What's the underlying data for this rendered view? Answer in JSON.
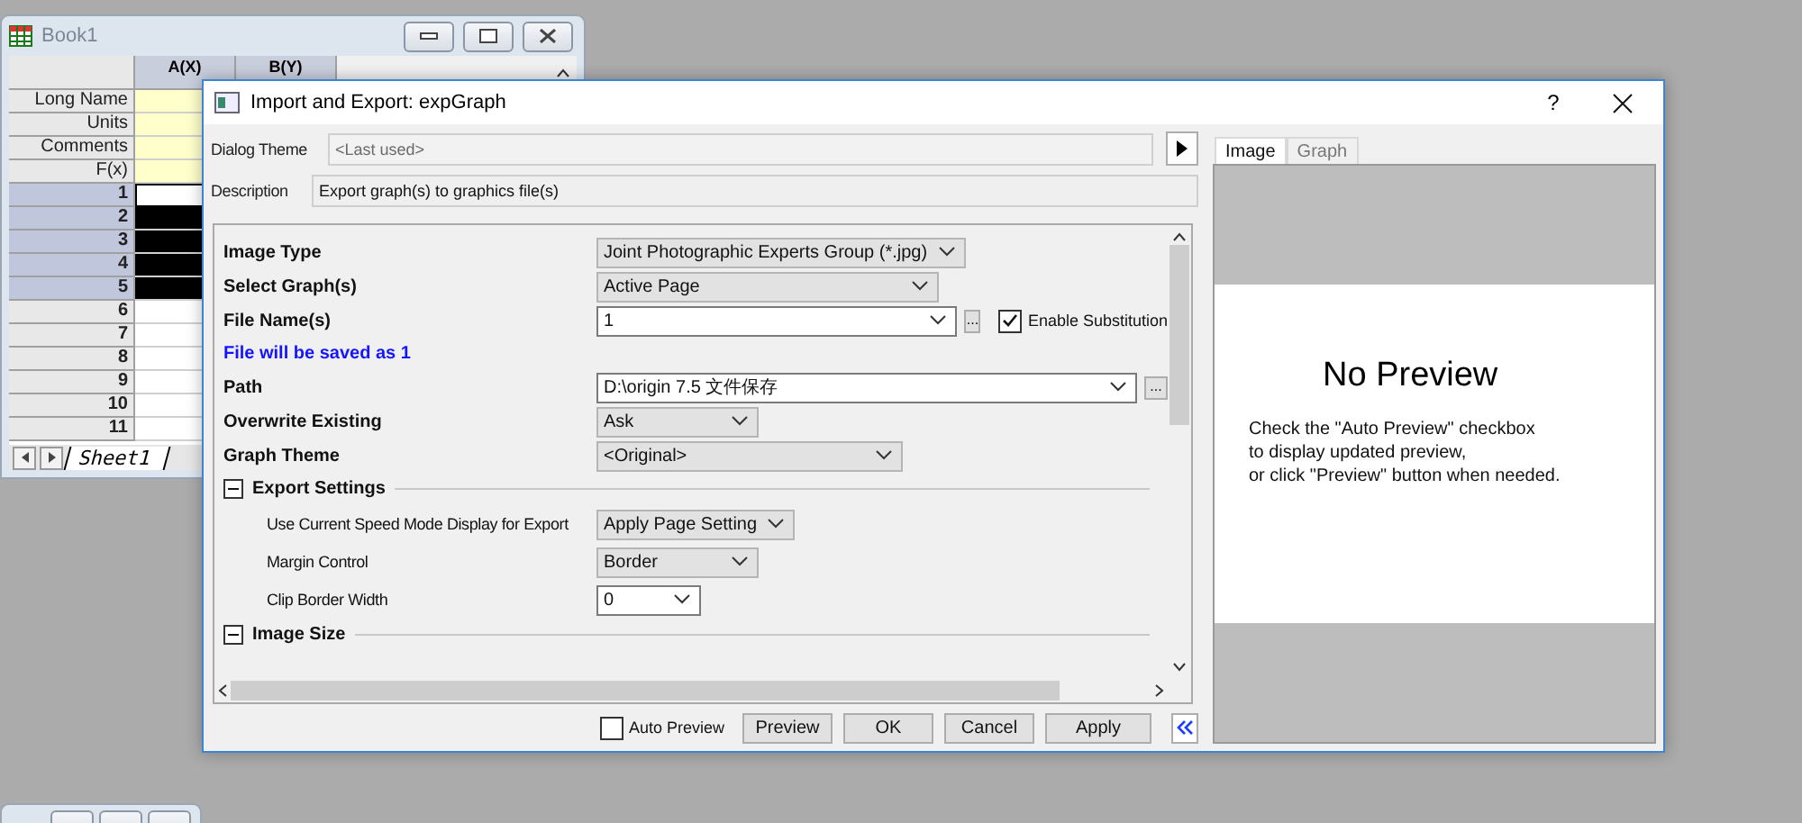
{
  "book_window": {
    "title": "Book1",
    "columns": [
      "A(X)",
      "B(Y)"
    ],
    "label_rows": [
      "Long Name",
      "Units",
      "Comments",
      "F(x)"
    ],
    "rows": [
      {
        "label": "1",
        "selected": true,
        "active": true
      },
      {
        "label": "2",
        "selected": true,
        "active": false
      },
      {
        "label": "3",
        "selected": true,
        "active": false
      },
      {
        "label": "4",
        "selected": true,
        "active": false
      },
      {
        "label": "5",
        "selected": true,
        "active": false
      },
      {
        "label": "6",
        "selected": false,
        "active": false
      },
      {
        "label": "7",
        "selected": false,
        "active": false
      },
      {
        "label": "8",
        "selected": false,
        "active": false
      },
      {
        "label": "9",
        "selected": false,
        "active": false
      },
      {
        "label": "10",
        "selected": false,
        "active": false
      },
      {
        "label": "11",
        "selected": false,
        "active": false
      }
    ],
    "sheet_tab": "Sheet1"
  },
  "dialog": {
    "title": "Import and Export: expGraph",
    "help": "?",
    "theme": {
      "label": "Dialog Theme",
      "value": "<Last used>",
      "disabled": true
    },
    "description": {
      "label": "Description",
      "value": "Export graph(s) to graphics file(s)"
    },
    "settings": [
      {
        "kind": "select",
        "label": "Image Type",
        "value": "Joint Photographic Experts Group (*.jpg)"
      },
      {
        "kind": "select",
        "label": "Select Graph(s)",
        "value": "Active Page"
      },
      {
        "kind": "combo",
        "label": "File Name(s)",
        "value": "1",
        "browse": "...",
        "option": {
          "label": "Enable Substitution",
          "checked": true
        }
      },
      {
        "kind": "note",
        "label": "File will be saved as 1"
      },
      {
        "kind": "combo",
        "label": "Path",
        "value": "D:\\origin 7.5 文件保存",
        "browse": "..."
      },
      {
        "kind": "select",
        "label": "Overwrite Existing",
        "value": "Ask"
      },
      {
        "kind": "select",
        "label": "Graph Theme",
        "value": "<Original>"
      },
      {
        "kind": "group",
        "label": "Export Settings",
        "expanded": true,
        "children": [
          {
            "kind": "select",
            "label": "Use Current Speed Mode Display for Export",
            "value": "Apply Page Setting"
          },
          {
            "kind": "select",
            "label": "Margin Control",
            "value": "Border"
          },
          {
            "kind": "combo",
            "label": "Clip Border Width",
            "value": "0"
          }
        ]
      },
      {
        "kind": "group",
        "label": "Image Size",
        "expanded": true
      }
    ],
    "auto_preview": {
      "label": "Auto Preview",
      "checked": false
    },
    "buttons": [
      "Preview",
      "OK",
      "Cancel",
      "Apply"
    ],
    "preview_tabs": [
      {
        "label": "Image",
        "selected": true
      },
      {
        "label": "Graph",
        "selected": false
      }
    ],
    "preview": {
      "heading": "No Preview",
      "message": "Check the \"Auto Preview\" checkbox\nto display updated preview,\nor click \"Preview\" button when needed."
    }
  }
}
